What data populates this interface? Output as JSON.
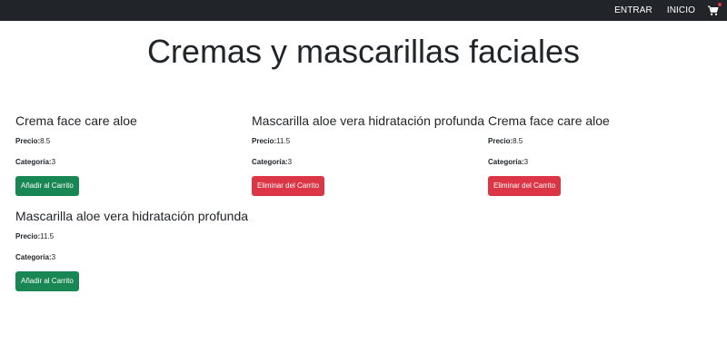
{
  "navbar": {
    "links": [
      "ENTRAR",
      "INICIO"
    ],
    "cart_icon": "shopping-cart-icon",
    "cart_badge_color": "#dc3545"
  },
  "page": {
    "title": "Cremas y mascarillas faciales"
  },
  "labels": {
    "price": "Precio:",
    "category": "Categoría:"
  },
  "products": [
    {
      "name": "Crema face care aloe",
      "price": "8.5",
      "category": "3",
      "button": "Añadir al Carrito",
      "button_type": "add"
    },
    {
      "name": "Mascarilla aloe vera hidratación profunda",
      "price": "11.5",
      "category": "3",
      "button": "Eliminar del Carrito",
      "button_type": "remove"
    },
    {
      "name": "Crema face care aloe",
      "price": "8.5",
      "category": "3",
      "button": "Eliminar del Carrito",
      "button_type": "remove"
    },
    {
      "name": "Mascarilla aloe vera hidratación profunda",
      "price": "11.5",
      "category": "3",
      "button": "Añadir al Carrito",
      "button_type": "add"
    }
  ],
  "colors": {
    "navbar_bg": "#212529",
    "add_button": "#198754",
    "remove_button": "#dc3545"
  }
}
